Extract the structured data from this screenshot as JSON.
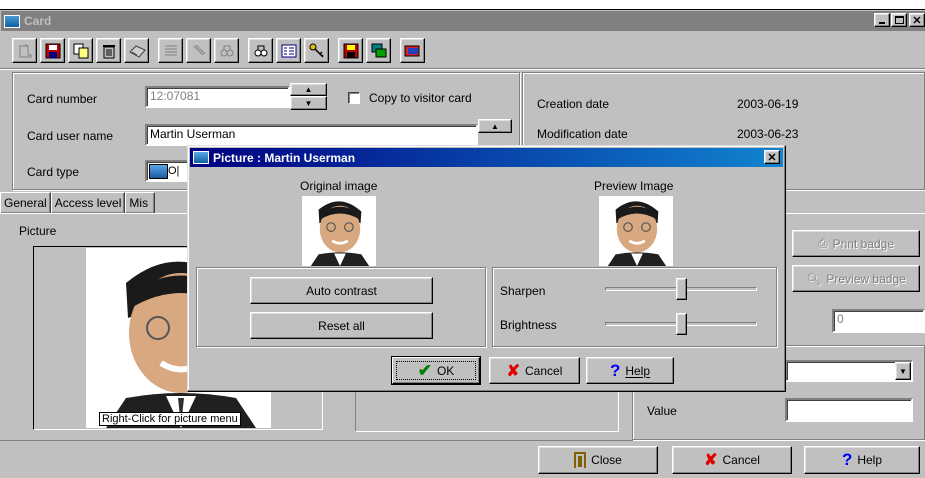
{
  "window": {
    "title": "Card"
  },
  "toolbar": {
    "icons": [
      "new-icon",
      "save-icon",
      "copy-icon",
      "delete-icon",
      "print-icon",
      "list-icon",
      "edit-icon",
      "find-icon",
      "search-all-icon",
      "grid-icon",
      "key-icon",
      "disk-icon",
      "windows-icon",
      "card-icon"
    ]
  },
  "form": {
    "card_number_label": "Card number",
    "card_number_value": "12:07081",
    "copy_to_visitor_label": "Copy to visitor card",
    "card_user_name_label": "Card user name",
    "card_user_name_value": "Martin Userman",
    "card_type_label": "Card type",
    "card_type_value": "O|",
    "creation_date_label": "Creation date",
    "creation_date_value": "2003-06-19",
    "modification_date_label": "Modification date",
    "modification_date_value": "2003-06-23"
  },
  "tabs": [
    {
      "label": "General"
    },
    {
      "label": "Access level"
    },
    {
      "label": "Mis"
    }
  ],
  "picture_panel": {
    "label": "Picture",
    "caption": "Right-Click for picture menu"
  },
  "right_panel": {
    "print_badge_label": "Print badge",
    "preview_badge_label": "Preview badge",
    "number_value": "0",
    "value_label": "Value"
  },
  "bottom_buttons": {
    "close": "Close",
    "cancel": "Cancel",
    "help": "Help"
  },
  "dialog": {
    "title": "Picture : Martin Userman",
    "original_label": "Original image",
    "preview_label": "Preview Image",
    "auto_contrast": "Auto contrast",
    "reset_all": "Reset all",
    "sharpen_label": "Sharpen",
    "brightness_label": "Brightness",
    "sharpen_level": 0.5,
    "brightness_level": 0.5,
    "ok": "OK",
    "cancel": "Cancel",
    "help": "Help"
  },
  "colors": {
    "titlebar": "#000080",
    "face": "#c0c0c0",
    "ok_check": "#008000",
    "cancel_x": "#e00000",
    "help_q": "#0000ff"
  }
}
